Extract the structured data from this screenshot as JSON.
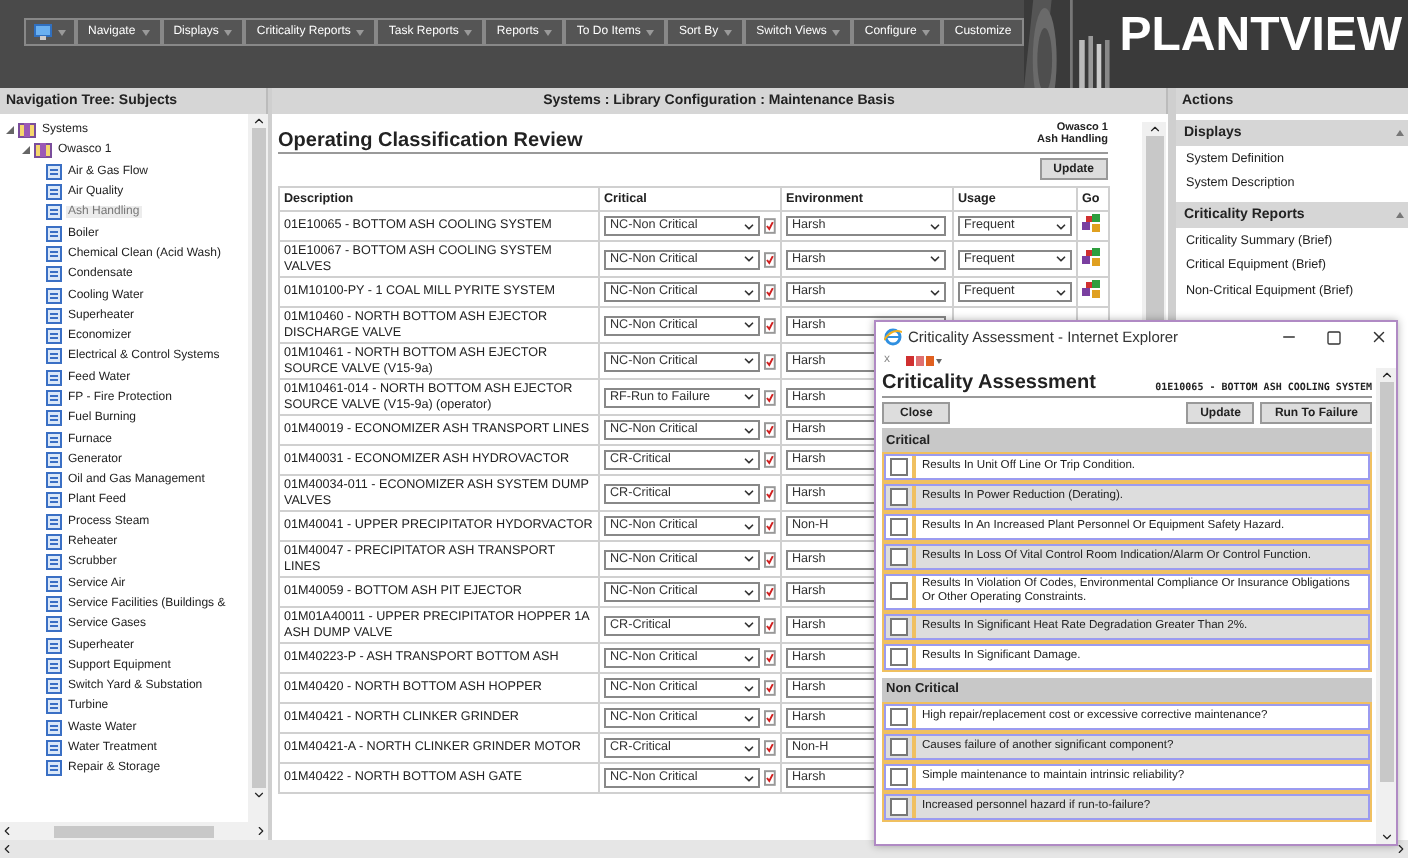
{
  "menu": {
    "items": [
      "Navigate",
      "Displays",
      "Criticality Reports",
      "Task Reports",
      "Reports",
      "To Do Items",
      "Sort By",
      "Switch Views",
      "Configure",
      "Customize"
    ],
    "logo": "PLANTVIEW"
  },
  "nav": {
    "title": "Navigation Tree: Subjects",
    "tree": [
      {
        "label": "Systems",
        "expanded": true,
        "selected": false,
        "children": [
          {
            "label": "Owasco 1",
            "expanded": true,
            "selected": false,
            "children": [
              {
                "label": "Air & Gas Flow",
                "selected": false
              },
              {
                "label": "Air Quality",
                "selected": false
              },
              {
                "label": "Ash Handling",
                "selected": true
              },
              {
                "label": "Boiler",
                "selected": false
              },
              {
                "label": "Chemical Clean (Acid Wash)",
                "selected": false
              },
              {
                "label": "Condensate",
                "selected": false
              },
              {
                "label": "Cooling Water",
                "selected": false
              },
              {
                "label": "Superheater",
                "selected": false
              },
              {
                "label": "Economizer",
                "selected": false
              },
              {
                "label": "Electrical & Control Systems",
                "selected": false
              },
              {
                "label": "Feed Water",
                "selected": false
              },
              {
                "label": "FP - Fire Protection",
                "selected": false
              },
              {
                "label": "Fuel Burning",
                "selected": false
              },
              {
                "label": "Furnace",
                "selected": false
              },
              {
                "label": "Generator",
                "selected": false
              },
              {
                "label": "Oil and Gas Management",
                "selected": false
              },
              {
                "label": "Plant Feed",
                "selected": false
              },
              {
                "label": "Process Steam",
                "selected": false
              },
              {
                "label": "Reheater",
                "selected": false
              },
              {
                "label": "Scrubber",
                "selected": false
              },
              {
                "label": "Service Air",
                "selected": false
              },
              {
                "label": "Service Facilities (Buildings &",
                "selected": false
              },
              {
                "label": "Service Gases",
                "selected": false
              },
              {
                "label": "Superheater",
                "selected": false
              },
              {
                "label": "Support Equipment",
                "selected": false
              },
              {
                "label": "Switch Yard & Substation",
                "selected": false
              },
              {
                "label": "Turbine",
                "selected": false
              },
              {
                "label": "Waste Water",
                "selected": false
              },
              {
                "label": "Water Treatment",
                "selected": false
              },
              {
                "label": "Repair & Storage",
                "selected": false
              }
            ]
          }
        ]
      }
    ]
  },
  "breadcrumb": "Systems : Library Configuration : Maintenance Basis",
  "review": {
    "title": "Operating Classification Review",
    "context": [
      "Owasco 1",
      "Ash Handling"
    ],
    "update": "Update",
    "columns": [
      "Description",
      "Critical",
      "Environment",
      "Usage",
      "Go"
    ],
    "rows": [
      {
        "description": "01E10065 - BOTTOM ASH COOLING SYSTEM",
        "critical": "NC-Non Critical",
        "environment": "Harsh",
        "usage": "Frequent"
      },
      {
        "description": "01E10067 - BOTTOM ASH COOLING SYSTEM VALVES",
        "critical": "NC-Non Critical",
        "environment": "Harsh",
        "usage": "Frequent"
      },
      {
        "description": "01M10100-PY - 1 COAL MILL PYRITE SYSTEM",
        "critical": "NC-Non Critical",
        "environment": "Harsh",
        "usage": "Frequent"
      },
      {
        "description": "01M10460 - NORTH BOTTOM ASH EJECTOR DISCHARGE VALVE",
        "critical": "NC-Non Critical",
        "environment": "Harsh"
      },
      {
        "description": "01M10461 - NORTH BOTTOM ASH EJECTOR SOURCE VALVE (V15-9a)",
        "critical": "NC-Non Critical",
        "environment": "Harsh"
      },
      {
        "description": "01M10461-014 - NORTH BOTTOM ASH EJECTOR SOURCE VALVE (V15-9a) (operator)",
        "critical": "RF-Run to Failure",
        "environment": "Harsh"
      },
      {
        "description": "01M40019 - ECONOMIZER ASH TRANSPORT LINES",
        "critical": "NC-Non Critical",
        "environment": "Harsh"
      },
      {
        "description": "01M40031 - ECONOMIZER ASH HYDROVACTOR",
        "critical": "CR-Critical",
        "environment": "Harsh"
      },
      {
        "description": "01M40034-011 - ECONOMIZER ASH SYSTEM DUMP VALVES",
        "critical": "CR-Critical",
        "environment": "Harsh"
      },
      {
        "description": "01M40041 - UPPER PRECIPITATOR HYDORVACTOR",
        "critical": "NC-Non Critical",
        "environment": "Non-H"
      },
      {
        "description": "01M40047 - PRECIPITATOR ASH TRANSPORT LINES",
        "critical": "NC-Non Critical",
        "environment": "Harsh"
      },
      {
        "description": "01M40059 - BOTTOM ASH PIT EJECTOR",
        "critical": "NC-Non Critical",
        "environment": "Harsh"
      },
      {
        "description": "01M01A40011 - UPPER PRECIPITATOR HOPPER 1A ASH DUMP VALVE",
        "critical": "CR-Critical",
        "environment": "Harsh"
      },
      {
        "description": "01M40223-P - ASH TRANSPORT BOTTOM ASH",
        "critical": "NC-Non Critical",
        "environment": "Harsh"
      },
      {
        "description": "01M40420 - NORTH BOTTOM ASH HOPPER",
        "critical": "NC-Non Critical",
        "environment": "Harsh"
      },
      {
        "description": "01M40421 - NORTH CLINKER GRINDER",
        "critical": "NC-Non Critical",
        "environment": "Harsh"
      },
      {
        "description": "01M40421-A - NORTH CLINKER GRINDER MOTOR",
        "critical": "CR-Critical",
        "environment": "Non-H"
      },
      {
        "description": "01M40422 - NORTH BOTTOM ASH GATE",
        "critical": "NC-Non Critical",
        "environment": "Harsh"
      }
    ]
  },
  "actions": {
    "title": "Actions",
    "sections": [
      {
        "title": "Displays",
        "expanded": true,
        "items": [
          "System Definition",
          "System Description"
        ]
      },
      {
        "title": "Criticality Reports",
        "expanded": true,
        "items": [
          "Criticality Summary (Brief)",
          "Critical Equipment (Brief)",
          "Non-Critical Equipment (Brief)"
        ]
      }
    ]
  },
  "popup": {
    "window_title": "Criticality Assessment - Internet Explorer",
    "toolbar_close": "x",
    "title": "Criticality Assessment",
    "equipment": "01E10065 - BOTTOM ASH COOLING SYSTEM",
    "buttons": {
      "close": "Close",
      "update": "Update",
      "run_to_failure": "Run To Failure"
    },
    "groups": [
      {
        "title": "Critical",
        "items": [
          {
            "label": "Results In Unit Off Line Or Trip Condition.",
            "checked": false
          },
          {
            "label": "Results In Power Reduction (Derating).",
            "checked": false
          },
          {
            "label": "Results In An Increased Plant Personnel Or Equipment Safety Hazard.",
            "checked": false
          },
          {
            "label": "Results In Loss Of Vital Control Room Indication/Alarm Or Control Function.",
            "checked": false
          },
          {
            "label": "Results In Violation Of Codes, Environmental Compliance Or Insurance Obligations Or Other Operating Constraints.",
            "checked": false
          },
          {
            "label": "Results In Significant Heat Rate Degradation Greater Than 2%.",
            "checked": false
          },
          {
            "label": "Results In Significant Damage.",
            "checked": false
          }
        ]
      },
      {
        "title": "Non Critical",
        "items": [
          {
            "label": "High repair/replacement cost or excessive corrective maintenance?",
            "checked": false
          },
          {
            "label": "Causes failure of another significant component?",
            "checked": false
          },
          {
            "label": "Simple maintenance to maintain intrinsic reliability?",
            "checked": false
          },
          {
            "label": "Increased personnel hazard if run-to-failure?",
            "checked": false
          }
        ]
      }
    ]
  }
}
